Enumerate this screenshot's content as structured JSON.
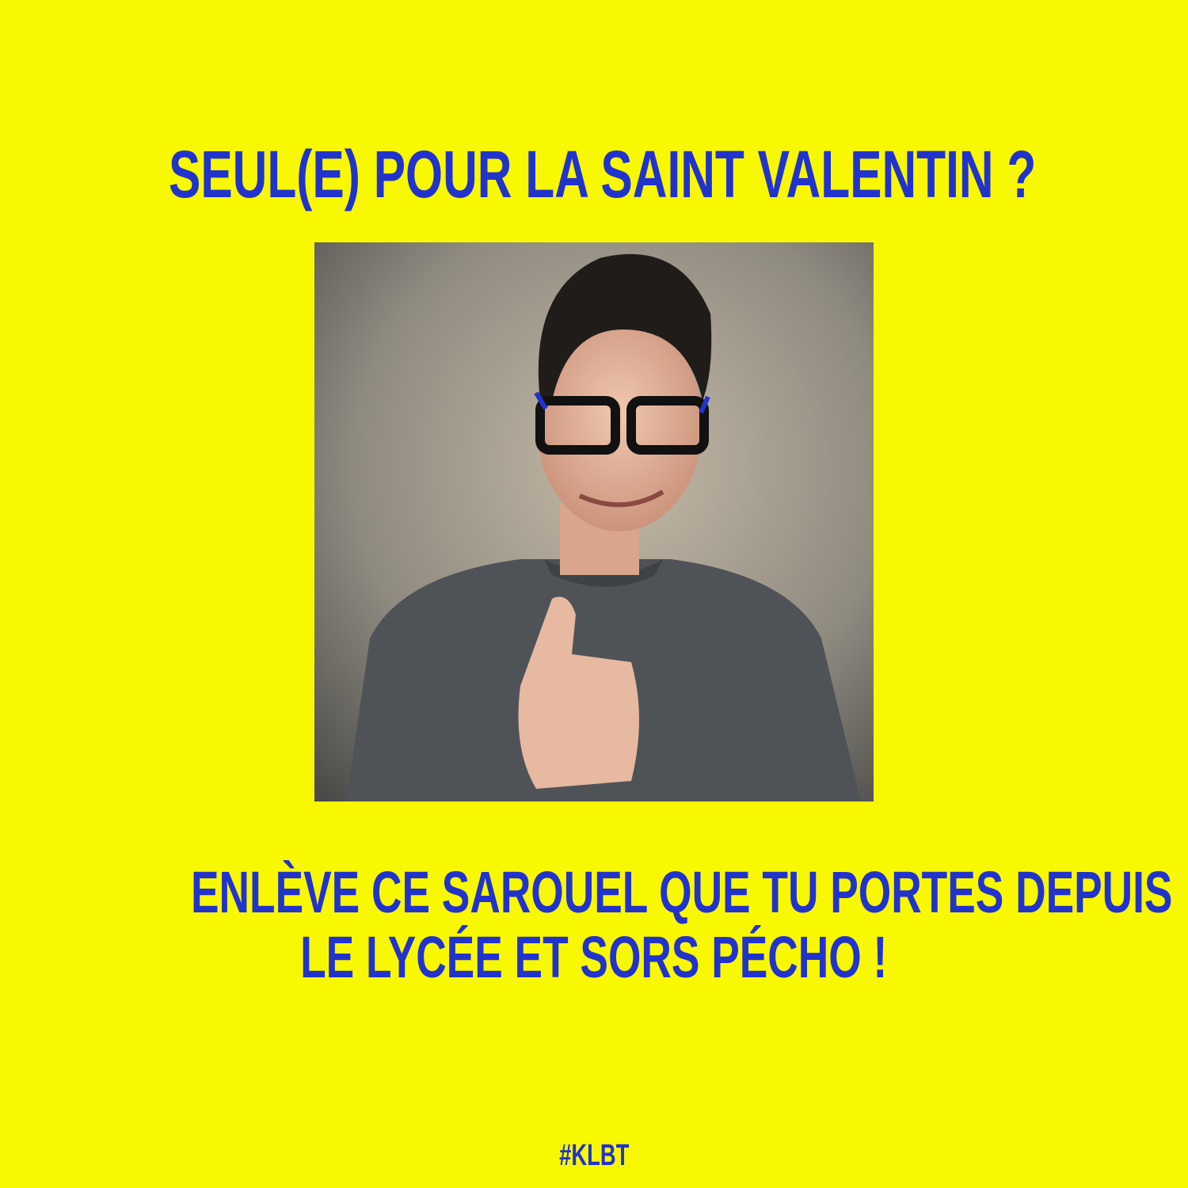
{
  "poster": {
    "title": "SEUL(E) POUR LA SAINT VALENTIN ?",
    "subtitle_line1": "ENLÈVE CE SAROUEL QUE TU PORTES DEPUIS",
    "subtitle_line2": "LE LYCÉE ET SORS PÉCHO !",
    "hashtag": "#KLBT"
  },
  "colors": {
    "background": "#f8f800",
    "text": "#2233cc"
  }
}
